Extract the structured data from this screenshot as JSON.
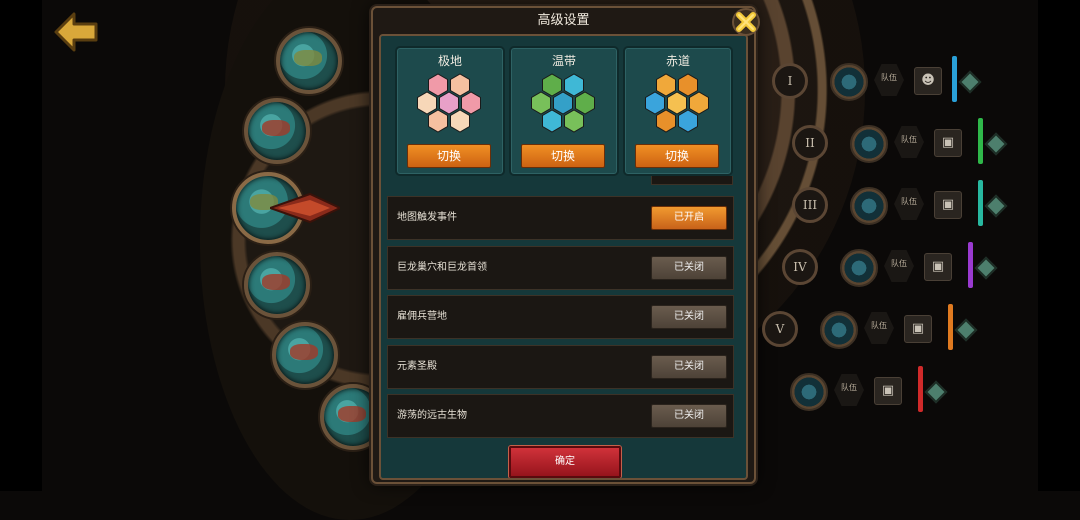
{
  "modal": {
    "title": "高级设置",
    "climates": [
      {
        "name": "极地",
        "button": "切换",
        "colors": [
          "#f09aa8",
          "#f5c0a0",
          "#f7d7b8",
          "#e8a0c8"
        ]
      },
      {
        "name": "温带",
        "button": "切换",
        "colors": [
          "#5fae4a",
          "#3fb8d6",
          "#78c05a",
          "#34a0c8"
        ]
      },
      {
        "name": "赤道",
        "button": "切换",
        "colors": [
          "#f0a83a",
          "#e8902a",
          "#3aa4dc",
          "#f5c050"
        ]
      }
    ],
    "settings": [
      {
        "label": "地图触发事件",
        "state": "已开启",
        "on": true
      },
      {
        "label": "巨龙巢穴和巨龙首领",
        "state": "已关闭",
        "on": false
      },
      {
        "label": "雇佣兵营地",
        "state": "已关闭",
        "on": false
      },
      {
        "label": "元素圣殿",
        "state": "已关闭",
        "on": false
      },
      {
        "label": "游荡的远古生物",
        "state": "已关闭",
        "on": false
      }
    ],
    "confirm": "确定"
  },
  "players": [
    {
      "roman": "I",
      "team_label": "队伍",
      "team": "1",
      "color": "#2aa0d8",
      "type": "person-icon"
    },
    {
      "roman": "II",
      "team_label": "队伍",
      "team": "2",
      "color": "#2fb84a",
      "type": "computer-icon"
    },
    {
      "roman": "III",
      "team_label": "队伍",
      "team": "2",
      "color": "#28b8a0",
      "type": "computer-icon"
    },
    {
      "roman": "IV",
      "team_label": "队伍",
      "team": "2",
      "color": "#9a3ad0",
      "type": "computer-icon"
    },
    {
      "roman": "V",
      "team_label": "队伍",
      "team": "2",
      "color": "#e07a20",
      "type": "computer-icon"
    },
    {
      "roman": "",
      "team_label": "队伍",
      "team": "2",
      "color": "#d02a2a",
      "type": "computer-icon"
    }
  ]
}
